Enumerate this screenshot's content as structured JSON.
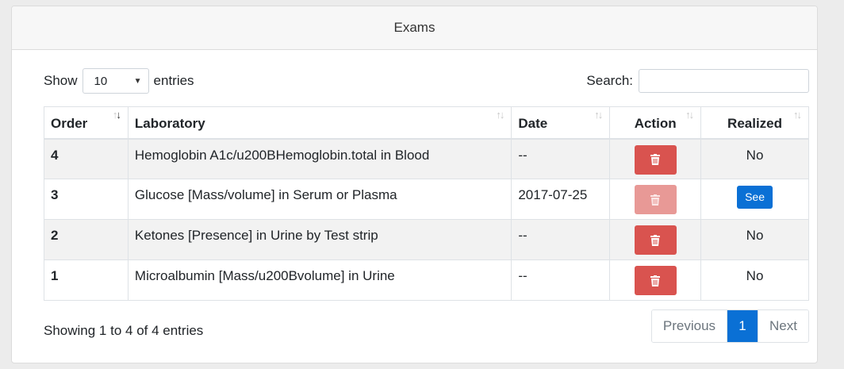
{
  "header": {
    "title": "Exams"
  },
  "length": {
    "show_label": "Show",
    "selected": "10",
    "entries_label": "entries"
  },
  "search": {
    "label": "Search:",
    "value": ""
  },
  "table": {
    "columns": [
      "Order",
      "Laboratory",
      "Date",
      "Action",
      "Realized"
    ],
    "rows": [
      {
        "order": "4",
        "laboratory": "Hemoglobin A1c/u200BHemoglobin.total in Blood",
        "date": "--",
        "realized": "No",
        "delete_disabled": false
      },
      {
        "order": "3",
        "laboratory": "Glucose [Mass/volume] in Serum or Plasma",
        "date": "2017-07-25",
        "realized": "See",
        "delete_disabled": true
      },
      {
        "order": "2",
        "laboratory": "Ketones [Presence] in Urine by Test strip",
        "date": "--",
        "realized": "No",
        "delete_disabled": false
      },
      {
        "order": "1",
        "laboratory": "Microalbumin [Mass/u200Bvolume] in Urine",
        "date": "--",
        "realized": "No",
        "delete_disabled": false
      }
    ]
  },
  "footer": {
    "info": "Showing 1 to 4 of 4 entries",
    "previous": "Previous",
    "page": "1",
    "next": "Next"
  },
  "colors": {
    "danger": "#d9534f",
    "primary": "#0a70d5"
  }
}
